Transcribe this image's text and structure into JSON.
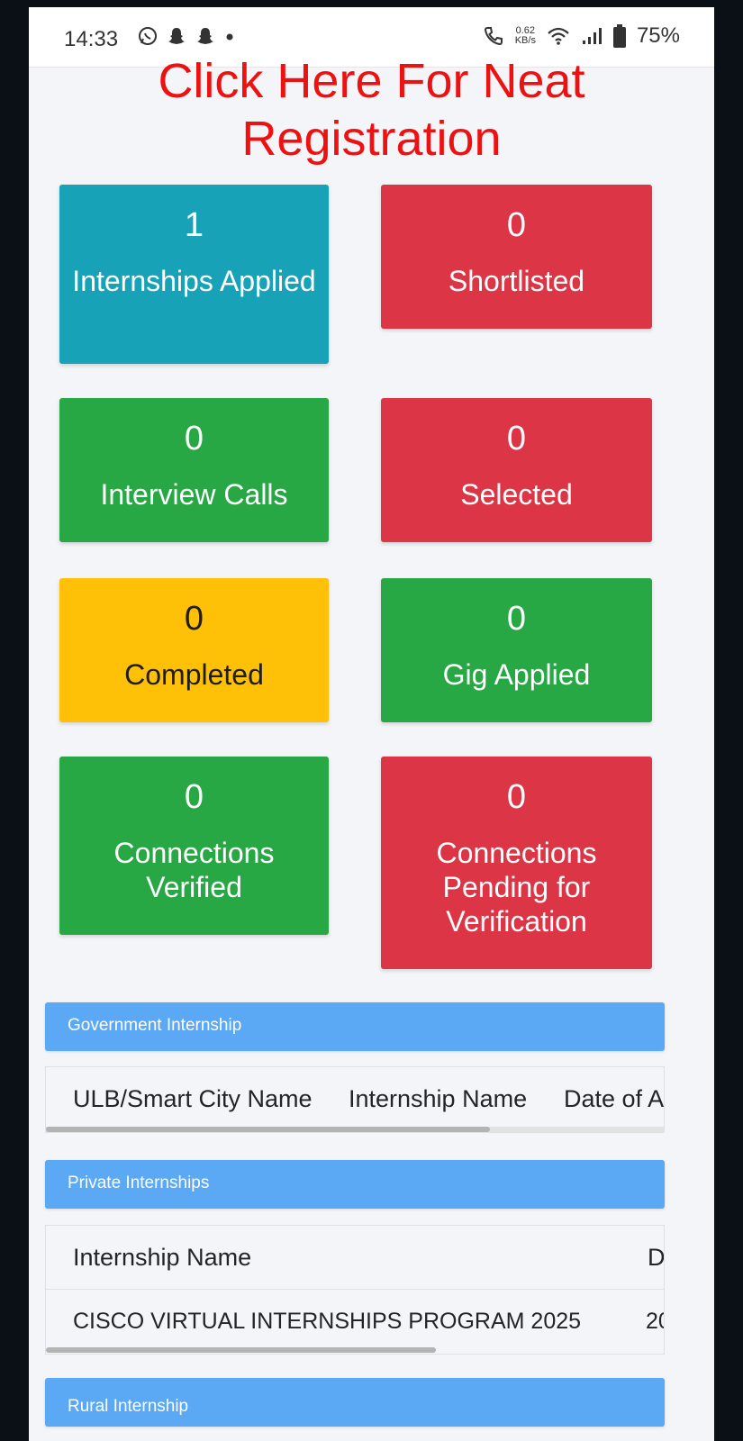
{
  "status_bar": {
    "time": "14:33",
    "speed_value": "0.62",
    "speed_unit": "KB/s",
    "battery": "75%"
  },
  "headline": {
    "line1": "Click Here For Neat",
    "line2": "Registration"
  },
  "stats": [
    {
      "count": "1",
      "label": "Internships Applied",
      "color": "#17a2b8"
    },
    {
      "count": "0",
      "label": "Shortlisted",
      "color": "#dc3545"
    },
    {
      "count": "0",
      "label": "Interview Calls",
      "color": "#28a745"
    },
    {
      "count": "0",
      "label": "Selected",
      "color": "#dc3545"
    },
    {
      "count": "0",
      "label": "Completed",
      "color": "#ffc107"
    },
    {
      "count": "0",
      "label": "Gig Applied",
      "color": "#28a745"
    },
    {
      "count": "0",
      "label": "Connections Verified",
      "color": "#28a745"
    },
    {
      "count": "0",
      "label": "Connections Pending for Verification",
      "color": "#dc3545"
    }
  ],
  "government": {
    "title": "Government Internship",
    "columns": [
      "ULB/Smart City Name",
      "Internship Name",
      "Date of A"
    ]
  },
  "private": {
    "title": "Private Internships",
    "columns": [
      "Internship Name",
      "D"
    ],
    "rows": [
      {
        "name": "CISCO VIRTUAL INTERNSHIPS PROGRAM 2025",
        "date": "20"
      }
    ]
  },
  "rural": {
    "title": "Rural Internship"
  }
}
